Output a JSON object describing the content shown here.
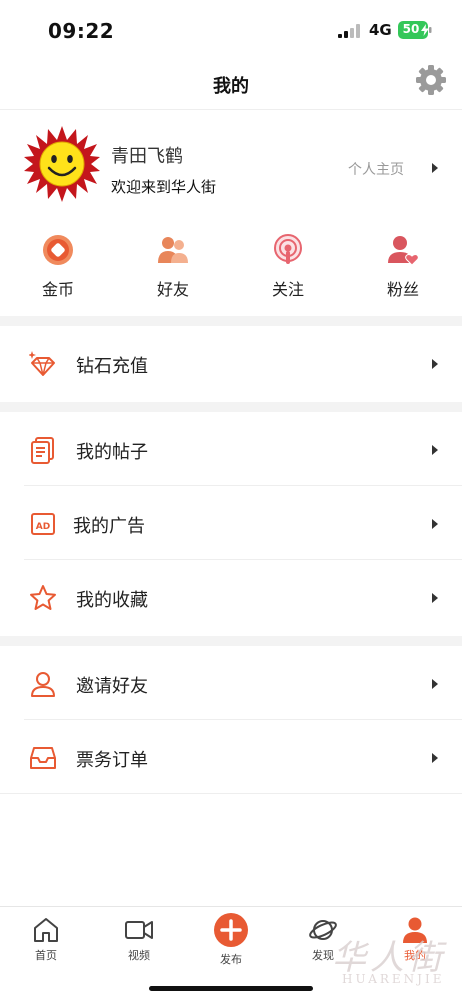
{
  "status_bar": {
    "time": "09:22",
    "network": "4G",
    "battery": "50"
  },
  "nav": {
    "title": "我的"
  },
  "profile": {
    "name": "青田飞鹤",
    "subtitle": "欢迎来到华人街",
    "link_label": "个人主页"
  },
  "stats": [
    {
      "label": "金币",
      "icon": "coin-icon"
    },
    {
      "label": "好友",
      "icon": "friends-icon"
    },
    {
      "label": "关注",
      "icon": "podcast-follow-icon"
    },
    {
      "label": "粉丝",
      "icon": "fans-heart-icon"
    }
  ],
  "menu": {
    "diamond": {
      "label": "钻石充值",
      "icon": "diamond-icon"
    },
    "posts": {
      "label": "我的帖子",
      "icon": "document-icon"
    },
    "ads": {
      "label": "我的广告",
      "icon": "ad-icon"
    },
    "favorites": {
      "label": "我的收藏",
      "icon": "star-icon"
    },
    "invite": {
      "label": "邀请好友",
      "icon": "person-icon"
    },
    "tickets": {
      "label": "票务订单",
      "icon": "inbox-icon"
    }
  },
  "tabs": [
    {
      "label": "首页",
      "icon": "home-icon"
    },
    {
      "label": "视频",
      "icon": "video-icon"
    },
    {
      "label": "发布",
      "icon": "plus-icon"
    },
    {
      "label": "发现",
      "icon": "planet-icon"
    },
    {
      "label": "我的",
      "icon": "user-icon",
      "active": true
    }
  ],
  "watermark": {
    "text": "华人街",
    "latin": "HUARENJIE"
  },
  "colors": {
    "accent": "#e85a33",
    "divider": "#f3f3f3"
  }
}
